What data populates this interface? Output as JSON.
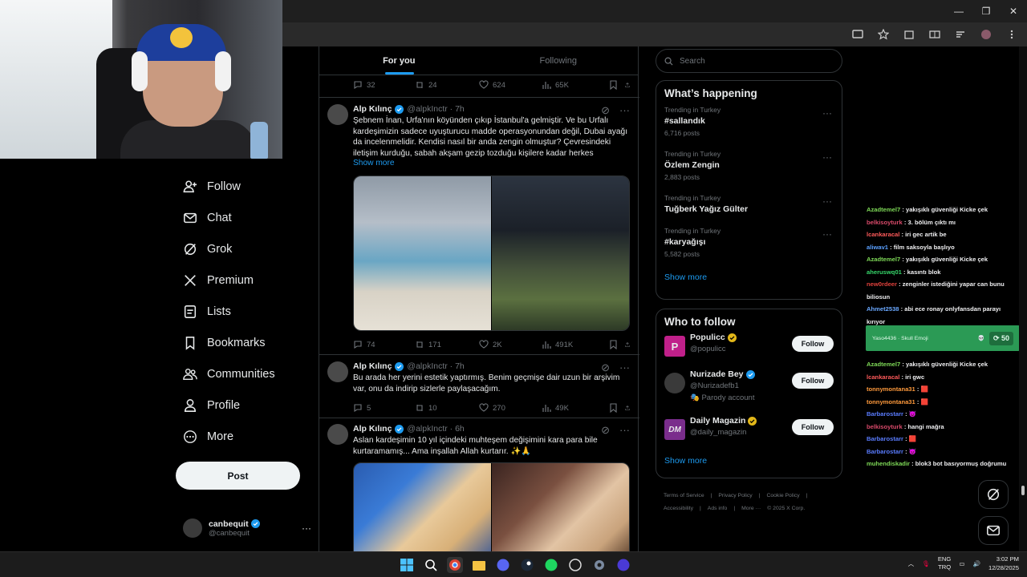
{
  "browser": {
    "window_controls": [
      "—",
      "❐",
      "✕"
    ]
  },
  "webcam": {
    "desc_icon": "webcam-overlay"
  },
  "nav": {
    "items": [
      {
        "icon": "follow-icon",
        "label": "Follow"
      },
      {
        "icon": "chat-icon",
        "label": "Chat"
      },
      {
        "icon": "grok-icon",
        "label": "Grok"
      },
      {
        "icon": "x-icon",
        "label": "Premium"
      },
      {
        "icon": "lists-icon",
        "label": "Lists"
      },
      {
        "icon": "bookmark-icon",
        "label": "Bookmarks"
      },
      {
        "icon": "communities-icon",
        "label": "Communities"
      },
      {
        "icon": "profile-icon",
        "label": "Profile"
      },
      {
        "icon": "more-circle-icon",
        "label": "More"
      }
    ],
    "post_label": "Post",
    "account": {
      "name": "canbequit",
      "handle": "@canbequit",
      "more": "···"
    }
  },
  "feed": {
    "tabs": [
      "For you",
      "Following"
    ],
    "top_actions": {
      "replies": "32",
      "reposts": "24",
      "likes": "624",
      "views": "65K"
    },
    "tweets": [
      {
        "name": "Alp Kılınç",
        "handle": "@alpkInctr · 7h",
        "text": "Şebnem İnan, Urfa'nın köyünden çıkıp İstanbul'a gelmiştir. Ve bu Urfalı kardeşimizin sadece uyuşturucu madde operasyonundan değil, Dubai ayağı da incelenmelidir. Kendisi nasıl bir anda zengin olmuştur? Çevresindeki iletişim kurduğu, sabah akşam gezip tozduğu kişilere kadar herkes",
        "show_more": "Show more",
        "actions": {
          "replies": "74",
          "reposts": "171",
          "likes": "2K",
          "views": "491K"
        }
      },
      {
        "name": "Alp Kılınç",
        "handle": "@alpkInctr · 7h",
        "text": "Bu arada her yerini estetik yaptırmış. Benim geçmişe dair uzun bir arşivim var, onu da indirip sizlerle paylaşacağım.",
        "actions": {
          "replies": "5",
          "reposts": "10",
          "likes": "270",
          "views": "49K"
        }
      },
      {
        "name": "Alp Kılınç",
        "handle": "@alpkInctr · 6h",
        "text": "Aslan kardeşimin 10 yıl içindeki muhteşem değişimini kara para bile kurtaramamış... Ama inşallah Allah kurtarır. ✨🙏"
      }
    ]
  },
  "right": {
    "search_placeholder": "Search",
    "happening_title": "What’s happening",
    "trends": [
      {
        "context": "Trending in Turkey",
        "topic": "#sallandık",
        "posts": "6,716 posts"
      },
      {
        "context": "Trending in Turkey",
        "topic": "Özlem Zengin",
        "posts": "2,883 posts"
      },
      {
        "context": "Trending in Turkey",
        "topic": "Tuğberk Yağız Gülter",
        "posts": ""
      },
      {
        "context": "Trending in Turkey",
        "topic": "#karyağışı",
        "posts": "5,582 posts"
      }
    ],
    "show_more": "Show more",
    "wtf_title": "Who to follow",
    "who_to_follow": [
      {
        "name": "Populicc",
        "handle": "@populicc",
        "badge": "gold",
        "extra": "",
        "av_color": "#c0208a",
        "av_text": "P"
      },
      {
        "name": "Nurizade Bey",
        "handle": "@Nurizadefb1",
        "badge": "blue",
        "extra": "Parody account",
        "av_color": "#3a3a3a",
        "av_text": ""
      },
      {
        "name": "Daily Magazin",
        "handle": "@daily_magazin",
        "badge": "gold",
        "extra": "",
        "av_color": "#7a2d8c",
        "av_text": "DM"
      }
    ],
    "follow_label": "Follow",
    "footer": [
      "Terms of Service",
      "|",
      "Privacy Policy",
      "|",
      "Cookie Policy",
      "|",
      "Accessibility",
      "|",
      "Ads info",
      "|",
      "More ···",
      "© 2025 X Corp."
    ]
  },
  "chat": {
    "messages": [
      {
        "user": "Azadtemel7",
        "color": "#7ed957",
        "text": "yakışıklı güvenliği Kicke çek"
      },
      {
        "user": "belkisoyturk",
        "color": "#d94a6a",
        "text": "3. bölüm çıktı mı"
      },
      {
        "user": "lcankaracal",
        "color": "#ff5a5a",
        "text": "iri gec artik be"
      },
      {
        "user": "aliwav1",
        "color": "#5aa0ff",
        "text": "film saksoyla başlıyo"
      },
      {
        "user": "Azadtemel7",
        "color": "#7ed957",
        "text": "yakışıklı güvenliği Kicke çek"
      },
      {
        "user": "aheruswq01",
        "color": "#36d66a",
        "text": "kasıntı blok"
      },
      {
        "user": "new0rdeer",
        "color": "#e0413c",
        "text": "zenginler istediğini yapar can bunu biliosun"
      },
      {
        "user": "Ahmet2538",
        "color": "#6aa8ff",
        "text": "abi ece ronay onlyfansdan parayı kırıyor"
      }
    ],
    "messages2": [
      {
        "user": "Azadtemel7",
        "color": "#7ed957",
        "text": "yakışıklı güvenliği Kicke çek"
      },
      {
        "user": "lcankaracal",
        "color": "#ff5a5a",
        "text": "iri gwc"
      },
      {
        "user": "tonnymontana31",
        "color": "#ff9a3c",
        "text": "🟥"
      },
      {
        "user": "tonnymontana31",
        "color": "#ff9a3c",
        "text": "🟥"
      },
      {
        "user": "Barbarostarr",
        "color": "#5a7cff",
        "text": "😈"
      },
      {
        "user": "belkisoyturk",
        "color": "#d94a6a",
        "text": "hangi mağra"
      },
      {
        "user": "Barbarostarr",
        "color": "#5a7cff",
        "text": "🟥"
      },
      {
        "user": "Barbarostarr",
        "color": "#5a7cff",
        "text": "😈"
      },
      {
        "user": "muhendiskadir",
        "color": "#7ed957",
        "text": "blok3 bot basıyormuş doğrumu"
      }
    ],
    "redeem": {
      "text": "Yaso4436  · Skull Emoji",
      "points": "50"
    }
  },
  "taskbar": {
    "lang": "ENG",
    "lang2": "TRQ",
    "time": "3:02 PM",
    "date": "12/28/2025"
  }
}
